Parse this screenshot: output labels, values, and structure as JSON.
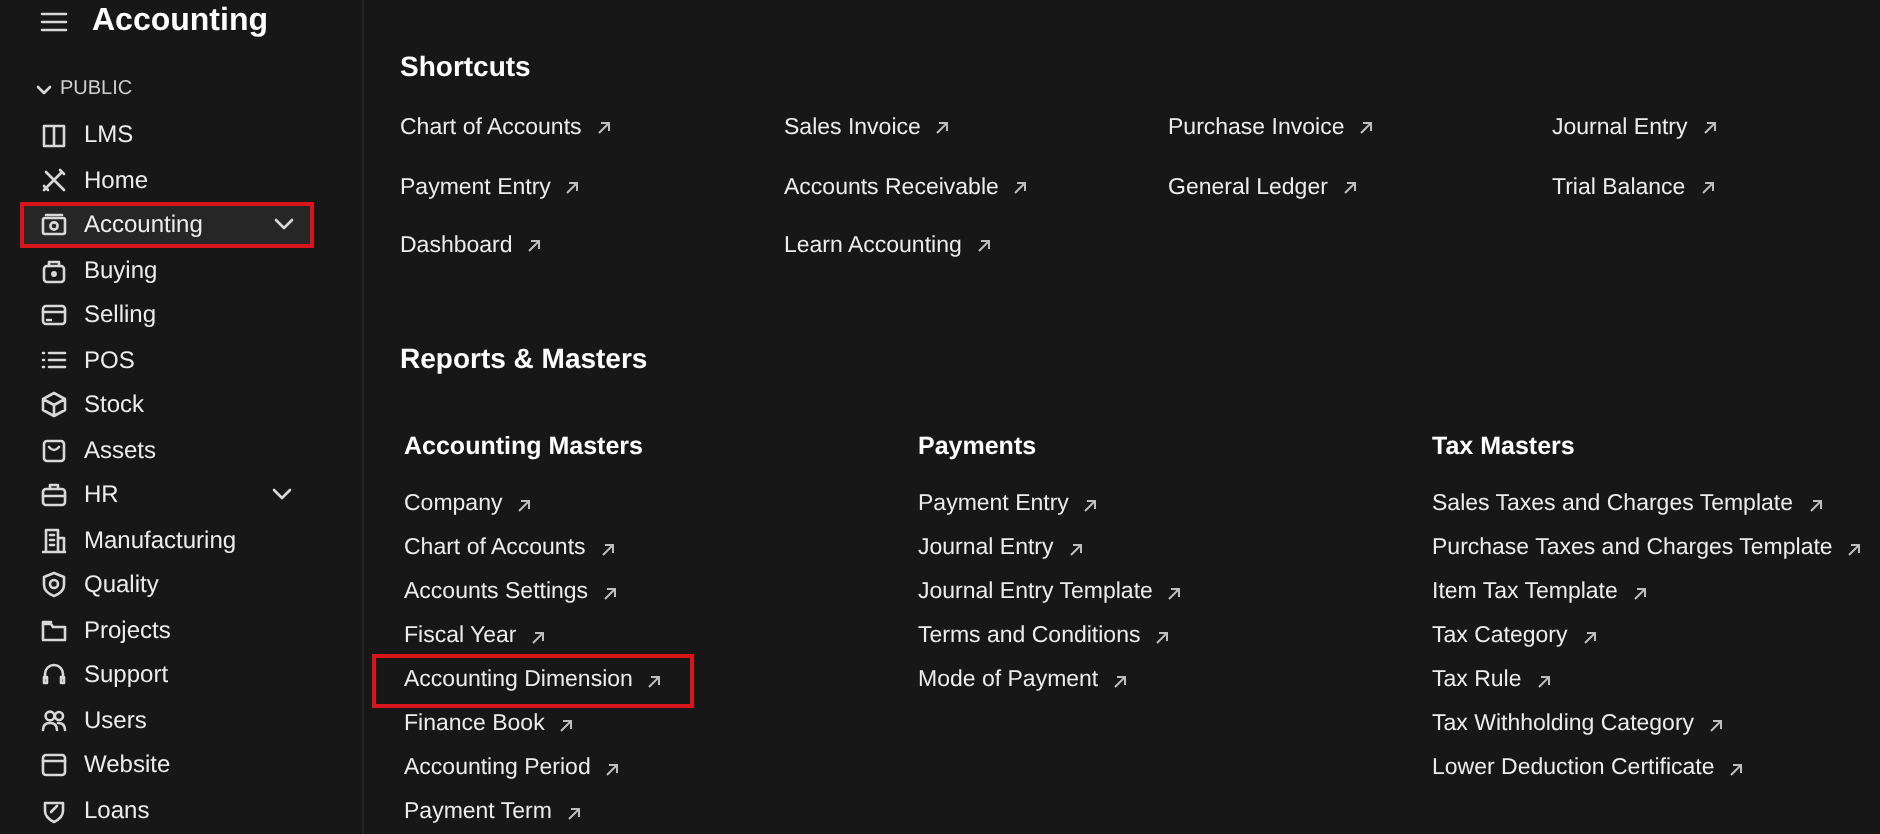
{
  "header": {
    "title": "Accounting"
  },
  "sidebar": {
    "section": "PUBLIC",
    "items": [
      {
        "label": "LMS",
        "selected": false,
        "expandable": false,
        "highlighted": false
      },
      {
        "label": "Home",
        "selected": false,
        "expandable": false,
        "highlighted": false
      },
      {
        "label": "Accounting",
        "selected": true,
        "expandable": true,
        "highlighted": true
      },
      {
        "label": "Buying",
        "selected": false,
        "expandable": false,
        "highlighted": false
      },
      {
        "label": "Selling",
        "selected": false,
        "expandable": false,
        "highlighted": false
      },
      {
        "label": "POS",
        "selected": false,
        "expandable": false,
        "highlighted": false
      },
      {
        "label": "Stock",
        "selected": false,
        "expandable": false,
        "highlighted": false
      },
      {
        "label": "Assets",
        "selected": false,
        "expandable": false,
        "highlighted": false
      },
      {
        "label": "HR",
        "selected": false,
        "expandable": true,
        "highlighted": false
      },
      {
        "label": "Manufacturing",
        "selected": false,
        "expandable": false,
        "highlighted": false
      },
      {
        "label": "Quality",
        "selected": false,
        "expandable": false,
        "highlighted": false
      },
      {
        "label": "Projects",
        "selected": false,
        "expandable": false,
        "highlighted": false
      },
      {
        "label": "Support",
        "selected": false,
        "expandable": false,
        "highlighted": false
      },
      {
        "label": "Users",
        "selected": false,
        "expandable": false,
        "highlighted": false
      },
      {
        "label": "Website",
        "selected": false,
        "expandable": false,
        "highlighted": false
      },
      {
        "label": "Loans",
        "selected": false,
        "expandable": false,
        "highlighted": false
      }
    ]
  },
  "shortcuts": {
    "title": "Shortcuts",
    "items": [
      "Chart of Accounts",
      "Sales Invoice",
      "Purchase Invoice",
      "Journal Entry",
      "Payment Entry",
      "Accounts Receivable",
      "General Ledger",
      "Trial Balance",
      "Dashboard",
      "Learn Accounting"
    ]
  },
  "reports": {
    "title": "Reports & Masters",
    "cards": [
      {
        "title": "Accounting Masters",
        "links": [
          {
            "label": "Company",
            "highlighted": false
          },
          {
            "label": "Chart of Accounts",
            "highlighted": false
          },
          {
            "label": "Accounts Settings",
            "highlighted": false
          },
          {
            "label": "Fiscal Year",
            "highlighted": false
          },
          {
            "label": "Accounting Dimension",
            "highlighted": true
          },
          {
            "label": "Finance Book",
            "highlighted": false
          },
          {
            "label": "Accounting Period",
            "highlighted": false
          },
          {
            "label": "Payment Term",
            "highlighted": false
          }
        ]
      },
      {
        "title": "Payments",
        "links": [
          {
            "label": "Payment Entry",
            "highlighted": false
          },
          {
            "label": "Journal Entry",
            "highlighted": false
          },
          {
            "label": "Journal Entry Template",
            "highlighted": false
          },
          {
            "label": "Terms and Conditions",
            "highlighted": false
          },
          {
            "label": "Mode of Payment",
            "highlighted": false
          }
        ]
      },
      {
        "title": "Tax Masters",
        "links": [
          {
            "label": "Sales Taxes and Charges Template",
            "highlighted": false
          },
          {
            "label": "Purchase Taxes and Charges Template",
            "highlighted": false
          },
          {
            "label": "Item Tax Template",
            "highlighted": false
          },
          {
            "label": "Tax Category",
            "highlighted": false
          },
          {
            "label": "Tax Rule",
            "highlighted": false
          },
          {
            "label": "Tax Withholding Category",
            "highlighted": false
          },
          {
            "label": "Lower Deduction Certificate",
            "highlighted": false
          }
        ]
      }
    ]
  }
}
